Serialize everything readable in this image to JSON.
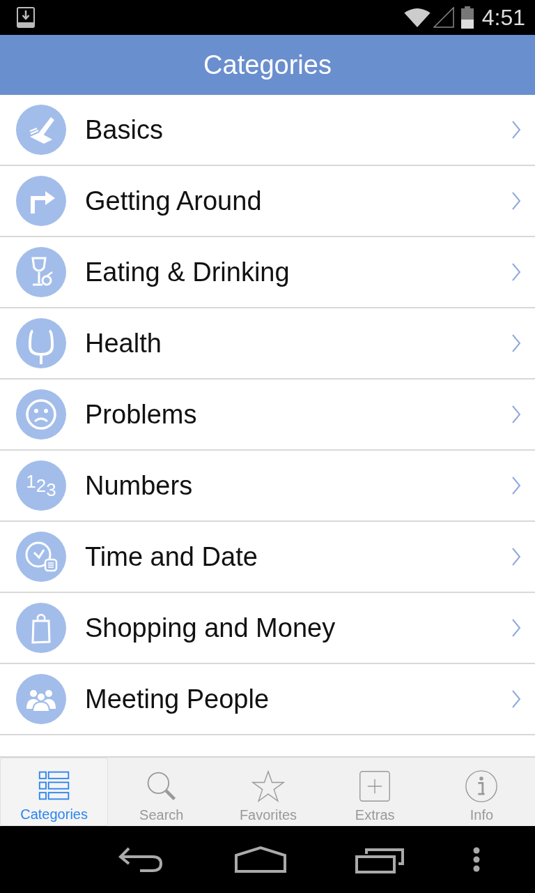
{
  "status_bar": {
    "time": "4:51"
  },
  "header": {
    "title": "Categories"
  },
  "categories": [
    {
      "label": "Basics"
    },
    {
      "label": "Getting Around"
    },
    {
      "label": "Eating & Drinking"
    },
    {
      "label": "Health"
    },
    {
      "label": "Problems"
    },
    {
      "label": "Numbers",
      "icon_digits": [
        "1",
        "2",
        "3"
      ]
    },
    {
      "label": "Time and Date"
    },
    {
      "label": "Shopping and Money"
    },
    {
      "label": "Meeting People"
    }
  ],
  "tabs": [
    {
      "label": "Categories",
      "selected": true
    },
    {
      "label": "Search",
      "selected": false
    },
    {
      "label": "Favorites",
      "selected": false
    },
    {
      "label": "Extras",
      "selected": false
    },
    {
      "label": "Info",
      "selected": false
    }
  ]
}
